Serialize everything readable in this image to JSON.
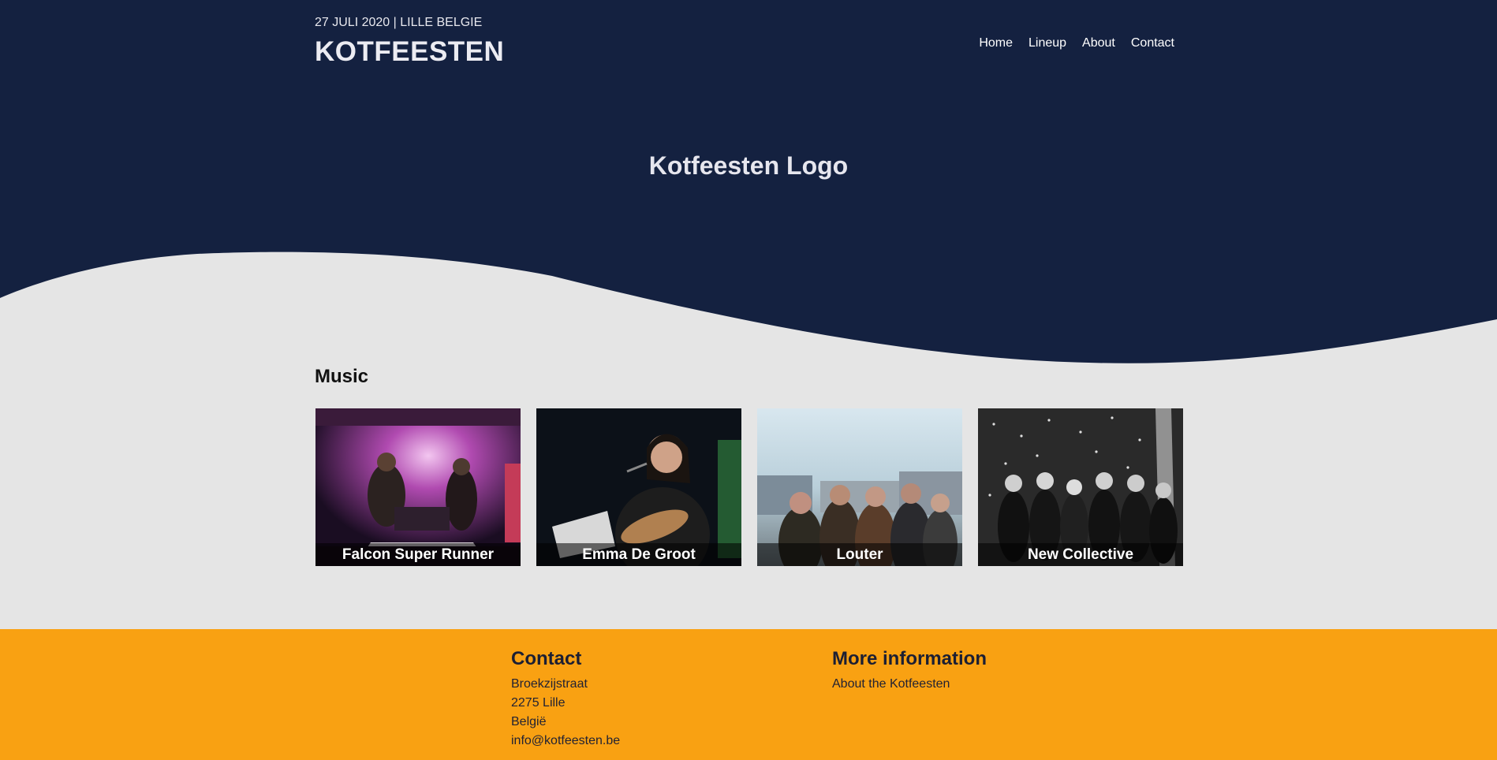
{
  "header": {
    "date_location": "27 JULI 2020 | LILLE BELGIE",
    "title": "KOTFEESTEN"
  },
  "nav": {
    "items": [
      "Home",
      "Lineup",
      "About",
      "Contact"
    ]
  },
  "hero": {
    "logo_text": "Kotfeesten Logo"
  },
  "music": {
    "title": "Music",
    "artists": [
      "Falcon Super Runner",
      "Emma De Groot",
      "Louter",
      "New Collective"
    ]
  },
  "footer": {
    "contact": {
      "title": "Contact",
      "street": "Broekzijstraat",
      "city": "2275 Lille",
      "country": "België",
      "email": "info@kotfeesten.be"
    },
    "more": {
      "title": "More information",
      "link": "About the Kotfeesten"
    }
  },
  "colors": {
    "navy": "#142140",
    "background": "#e5e5e5",
    "footer": "#f9a112"
  }
}
